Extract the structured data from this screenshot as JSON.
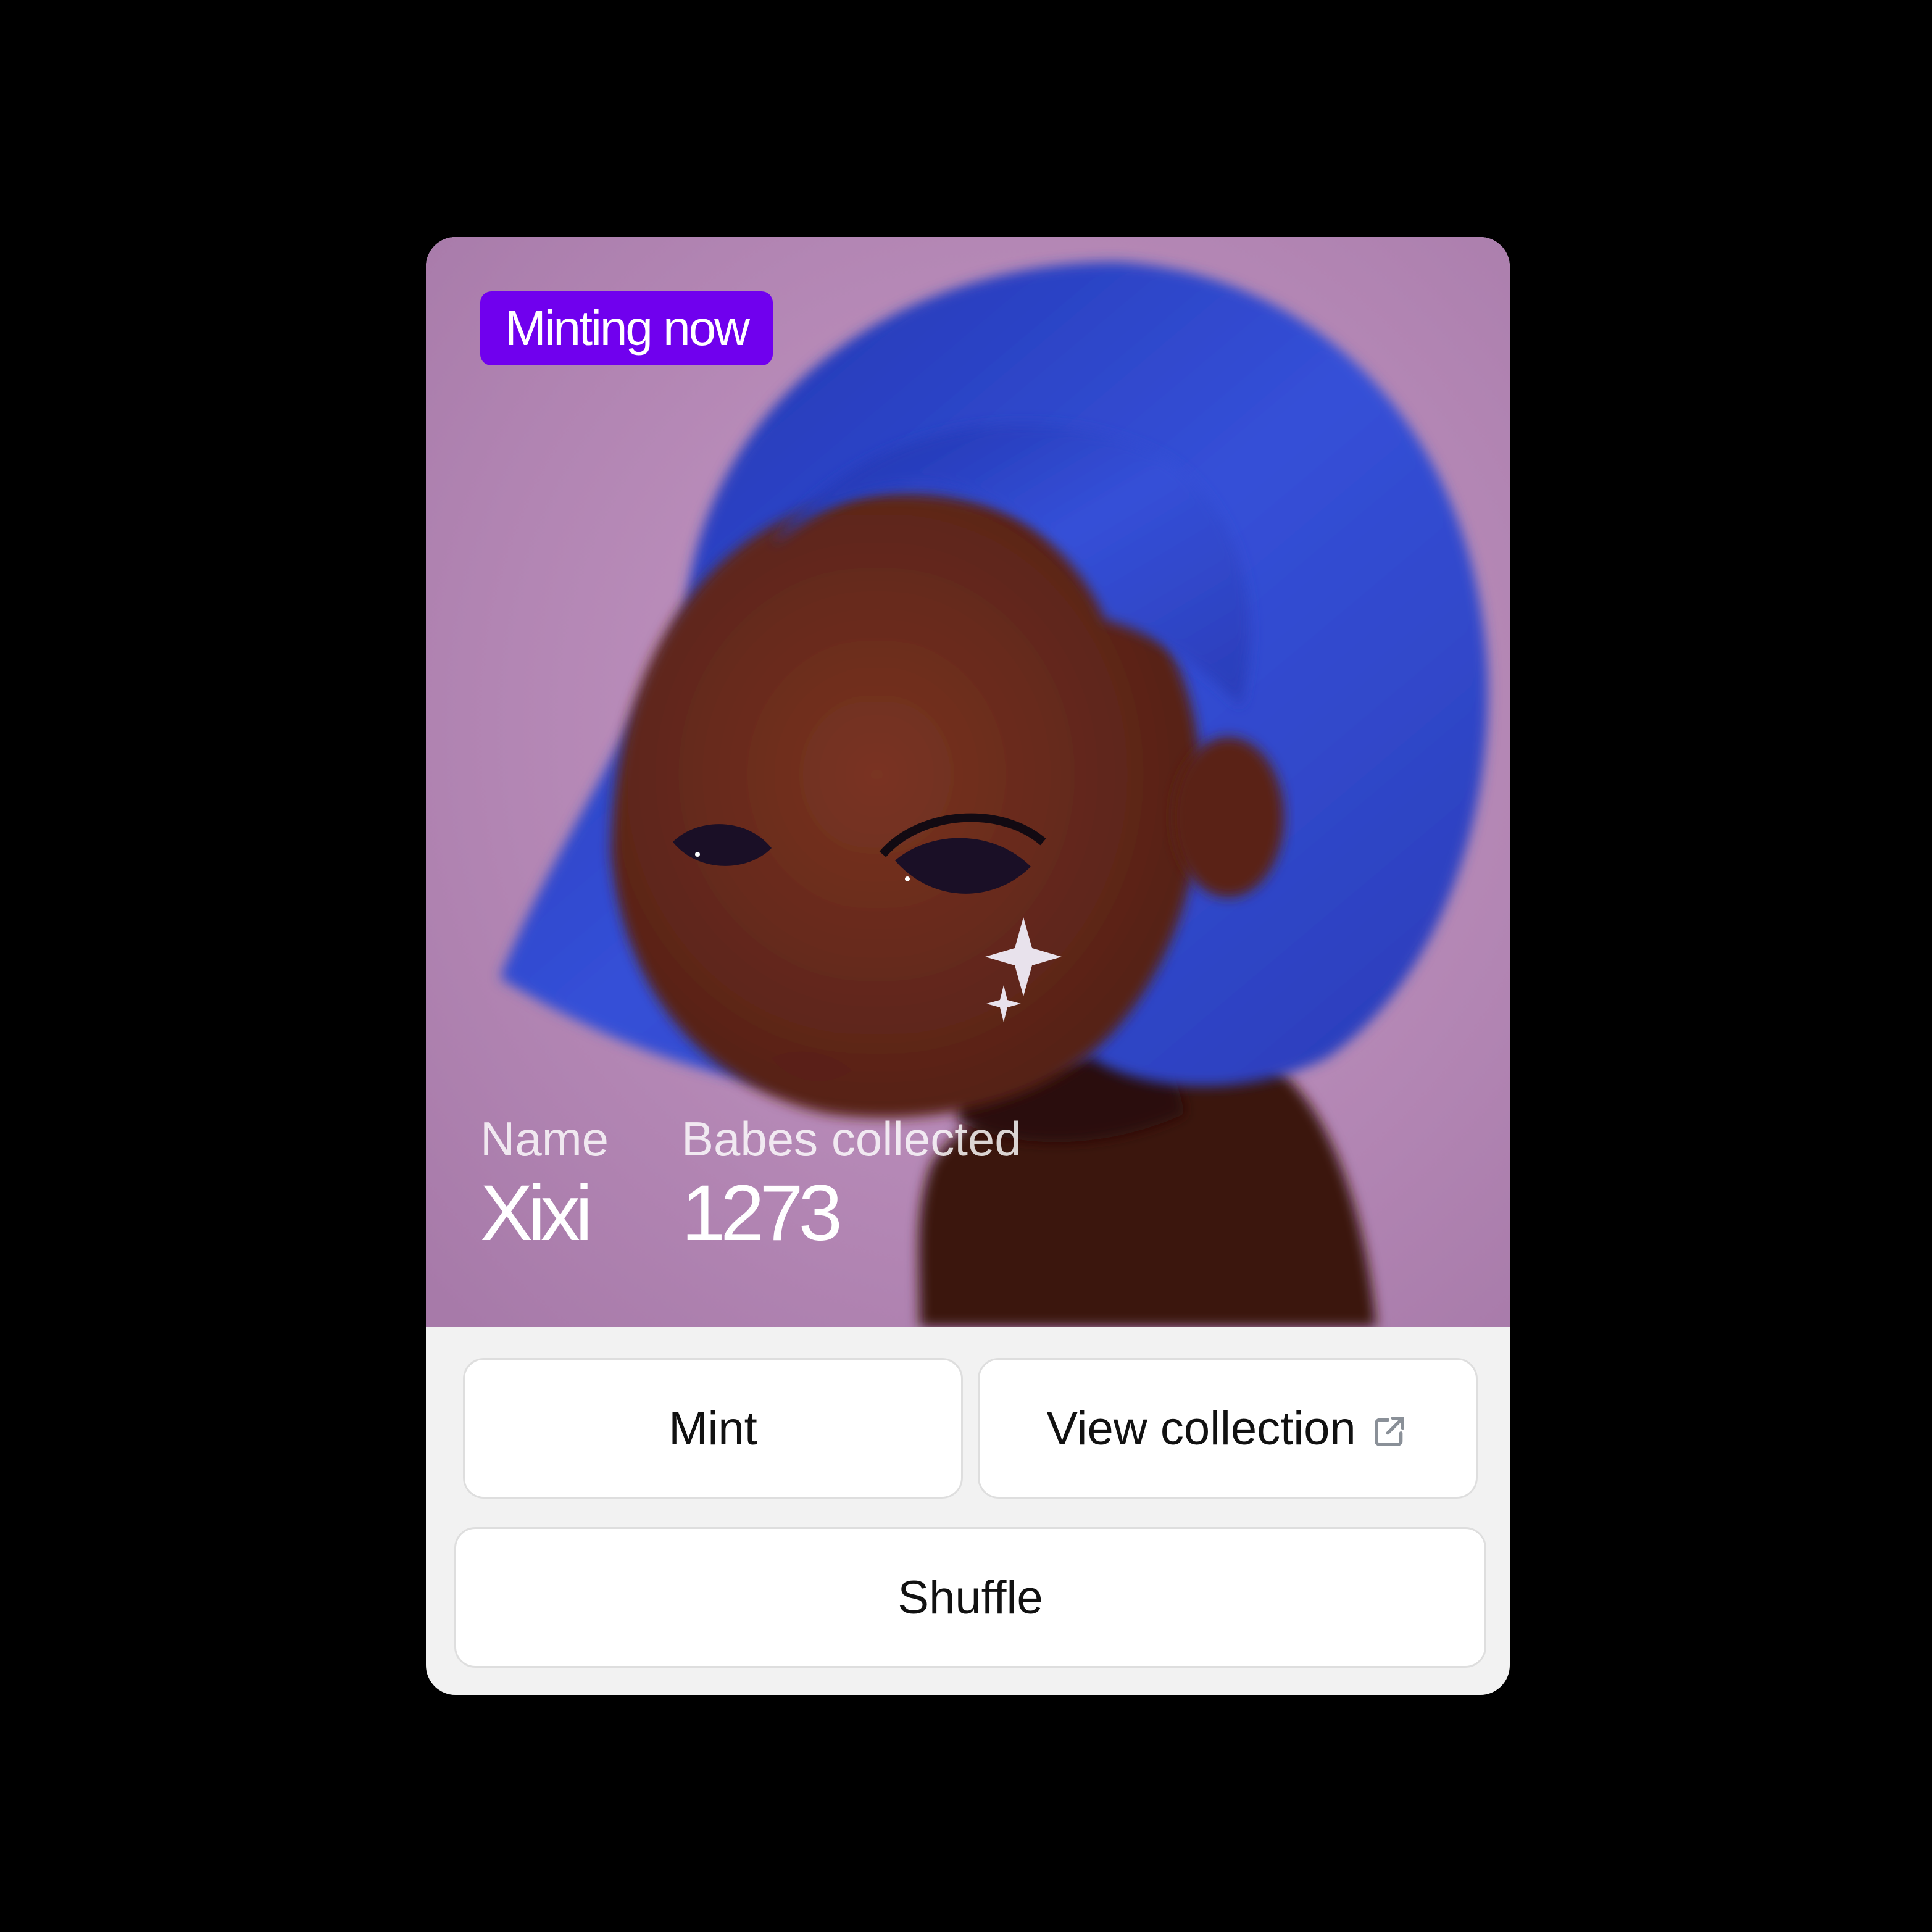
{
  "badge": {
    "label": "Minting now",
    "color": "#7000ee"
  },
  "stats": {
    "name_label": "Name",
    "name_value": "Xixi",
    "collected_label": "Babes collected",
    "collected_value": "1273"
  },
  "actions": {
    "mint_label": "Mint",
    "view_label": "View collection",
    "view_icon": "external-link-icon",
    "shuffle_label": "Shuffle"
  },
  "colors": {
    "page_background": "#000000",
    "art_background": "#b48ab7",
    "hair": "#2e45c9",
    "skin": "#6a2a1a",
    "panel": "#f2f2f2",
    "button": "#ffffff"
  }
}
